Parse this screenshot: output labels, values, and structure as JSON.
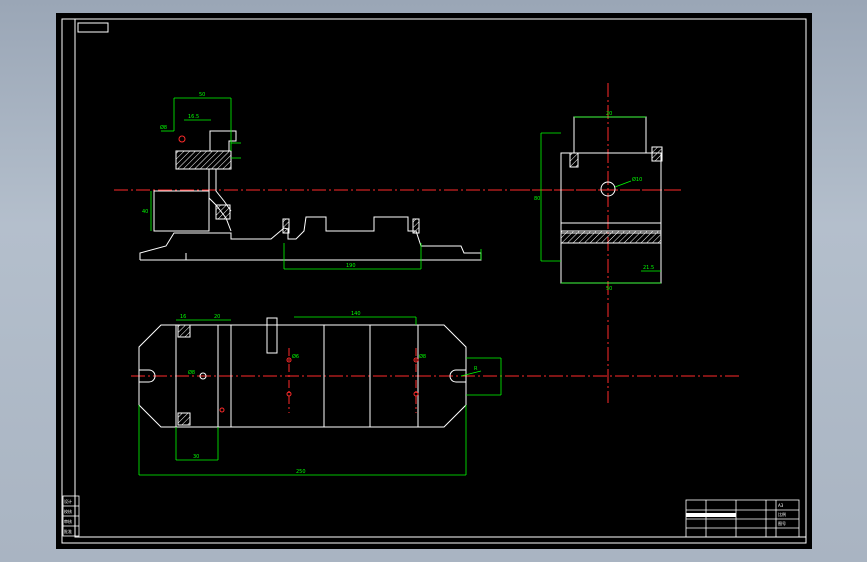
{
  "colors": {
    "background": "#000000",
    "outline": "#ffffff",
    "centerline": "#ff2a2a",
    "dimension": "#00ff00",
    "hatch": "#ffffff"
  },
  "dimension_labels": {
    "top_width": "50",
    "top_small": "16.5",
    "top_left_diam": "Ø8",
    "top_height": "40",
    "top_base_len": "190",
    "side_top_width": "20",
    "side_hole": "Ø10",
    "side_height": "80",
    "side_small": "21.5",
    "side_base_width": "50",
    "plan_left_a": "16",
    "plan_left_b": "20",
    "plan_span": "140",
    "plan_hole_a": "Ø6",
    "plan_hole_b": "Ø8",
    "plan_dia_center": "Ø8",
    "plan_width_sub": "30",
    "plan_total": "250",
    "plan_tab": "R"
  },
  "title_block": {
    "label_1": "A3",
    "label_2": "比例",
    "label_3": "图号"
  },
  "revision_block": {
    "r1": "设计",
    "r2": "校核",
    "r3": "审核",
    "r4": "批准"
  }
}
